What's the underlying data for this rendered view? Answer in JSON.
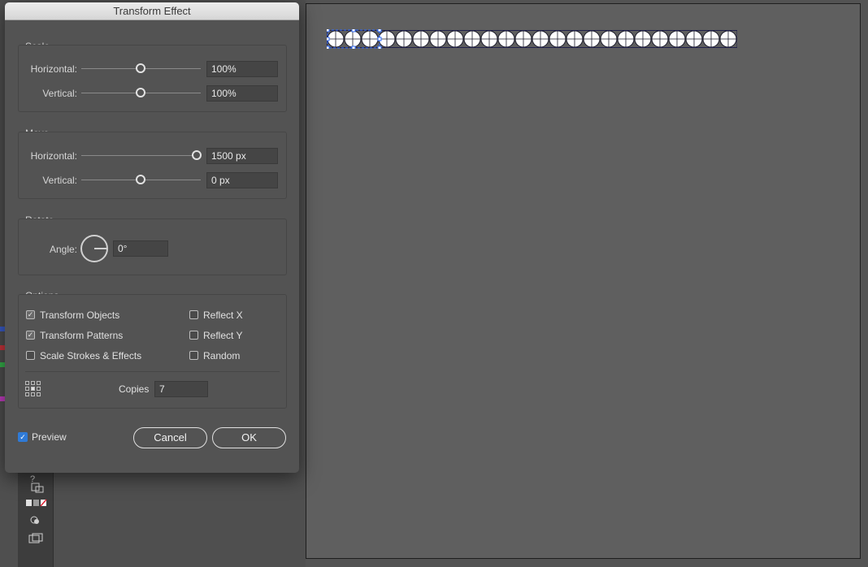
{
  "dialog": {
    "title": "Transform Effect",
    "scale": {
      "label": "Scale",
      "horizontal_label": "Horizontal:",
      "horizontal_value": "100%",
      "horizontal_level": 0.5,
      "vertical_label": "Vertical:",
      "vertical_value": "100%",
      "vertical_level": 0.5
    },
    "move": {
      "label": "Move",
      "horizontal_label": "Horizontal:",
      "horizontal_value": "1500 px",
      "horizontal_level": 1.0,
      "vertical_label": "Vertical:",
      "vertical_value": "0 px",
      "vertical_level": 0.5
    },
    "rotate": {
      "label": "Rotate",
      "angle_label": "Angle:",
      "angle_value": "0°"
    },
    "options": {
      "label": "Options",
      "transform_objects": "Transform Objects",
      "transform_patterns": "Transform Patterns",
      "scale_strokes": "Scale Strokes & Effects",
      "reflect_x": "Reflect X",
      "reflect_y": "Reflect Y",
      "random": "Random",
      "copies_label": "Copies",
      "copies_value": "7"
    },
    "preview_label": "Preview",
    "cancel_label": "Cancel",
    "ok_label": "OK"
  },
  "toolbar": {
    "help_glyph": "?"
  },
  "colors": {
    "dialog_bg": "#535353",
    "accent_blue": "#2f7ad6",
    "artboard_bg": "#5f5f5f"
  }
}
